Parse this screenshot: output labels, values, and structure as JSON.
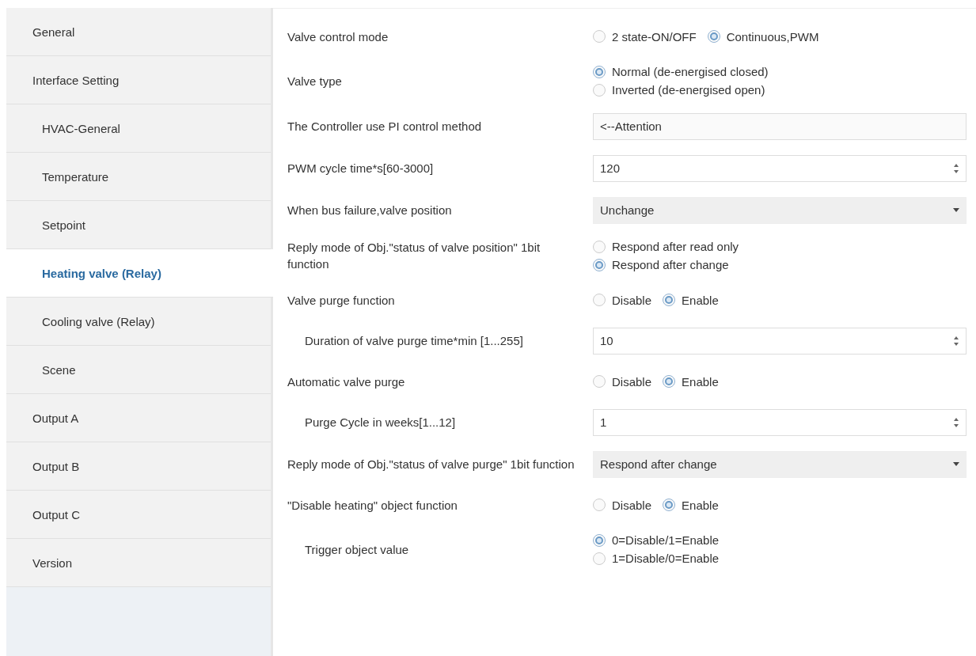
{
  "sidebar": {
    "items": [
      {
        "label": "General",
        "selected": false
      },
      {
        "label": "Interface Setting",
        "selected": false,
        "children": [
          {
            "label": "HVAC-General",
            "selected": false
          },
          {
            "label": "Temperature",
            "selected": false
          },
          {
            "label": "Setpoint",
            "selected": false
          },
          {
            "label": "Heating valve (Relay)",
            "selected": true
          },
          {
            "label": "Cooling valve (Relay)",
            "selected": false
          },
          {
            "label": "Scene",
            "selected": false
          }
        ]
      },
      {
        "label": "Output A",
        "selected": false
      },
      {
        "label": "Output B",
        "selected": false
      },
      {
        "label": "Output C",
        "selected": false
      },
      {
        "label": "Version",
        "selected": false
      }
    ]
  },
  "settings": [
    {
      "label": "Valve control mode",
      "kind": "radio-inline",
      "options": [
        {
          "label": "2 state-ON/OFF",
          "selected": false
        },
        {
          "label": "Continuous,PWM",
          "selected": true
        }
      ]
    },
    {
      "label": "Valve type",
      "kind": "radio-stacked",
      "options": [
        {
          "label": "Normal (de-energised closed)",
          "selected": true
        },
        {
          "label": "Inverted (de-energised open)",
          "selected": false
        }
      ]
    },
    {
      "label": "The Controller use PI control method",
      "kind": "text",
      "value": "<--Attention"
    },
    {
      "label": "PWM cycle time*s[60-3000]",
      "kind": "spinner",
      "value": "120"
    },
    {
      "label": "When bus failure,valve position",
      "kind": "dropdown",
      "value": "Unchange"
    },
    {
      "label": "Reply mode of Obj.\"status of valve position\" 1bit function",
      "kind": "radio-stacked",
      "options": [
        {
          "label": "Respond after read only",
          "selected": false
        },
        {
          "label": "Respond after change",
          "selected": true
        }
      ]
    },
    {
      "label": "Valve purge function",
      "kind": "radio-inline",
      "options": [
        {
          "label": "Disable",
          "selected": false
        },
        {
          "label": "Enable",
          "selected": true
        }
      ],
      "children": [
        {
          "label": "Duration of valve purge time*min [1...255]",
          "kind": "spinner",
          "value": "10"
        }
      ]
    },
    {
      "label": "Automatic valve purge",
      "kind": "radio-inline",
      "options": [
        {
          "label": "Disable",
          "selected": false
        },
        {
          "label": "Enable",
          "selected": true
        }
      ],
      "children": [
        {
          "label": "Purge Cycle in weeks[1...12]",
          "kind": "spinner",
          "value": "1"
        }
      ]
    },
    {
      "label": "Reply mode of Obj.\"status of valve purge\" 1bit function",
      "kind": "dropdown",
      "value": "Respond after change"
    },
    {
      "label": "\"Disable heating\" object function",
      "kind": "radio-inline",
      "options": [
        {
          "label": "Disable",
          "selected": false
        },
        {
          "label": "Enable",
          "selected": true
        }
      ],
      "children": [
        {
          "label": "Trigger object value",
          "kind": "radio-stacked",
          "options": [
            {
              "label": "0=Disable/1=Enable",
              "selected": true
            },
            {
              "label": "1=Disable/0=Enable",
              "selected": false
            }
          ]
        }
      ]
    }
  ]
}
